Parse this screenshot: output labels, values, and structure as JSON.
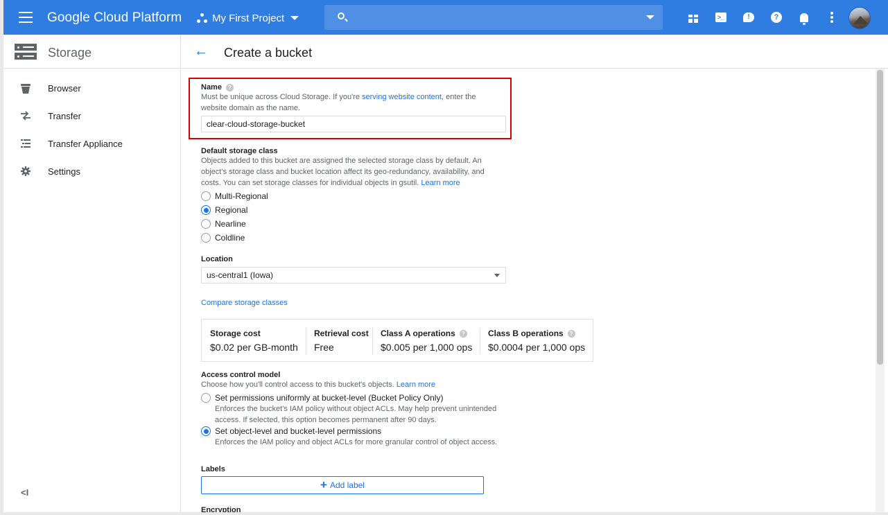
{
  "topbar": {
    "brand": "Google Cloud Platform",
    "project": "My First Project"
  },
  "sidebar": {
    "title": "Storage",
    "items": [
      {
        "label": "Browser",
        "icon": "bucket-icon"
      },
      {
        "label": "Transfer",
        "icon": "transfer-arrows-icon"
      },
      {
        "label": "Transfer Appliance",
        "icon": "list-icon"
      },
      {
        "label": "Settings",
        "icon": "gear-icon"
      }
    ],
    "collapse_glyph": "<I"
  },
  "header": {
    "title": "Create a bucket"
  },
  "form": {
    "name": {
      "label": "Name",
      "help_before": "Must be unique across Cloud Storage. If you're ",
      "help_link": "serving website content",
      "help_after": ", enter the website domain as the name.",
      "value": "clear-cloud-storage-bucket"
    },
    "storage_class": {
      "label": "Default storage class",
      "help": "Objects added to this bucket are assigned the selected storage class by default. An object's storage class and bucket location affect its geo-redundancy, availability, and costs. You can set storage classes for individual objects in gsutil.",
      "learn_more": "Learn more",
      "options": [
        "Multi-Regional",
        "Regional",
        "Nearline",
        "Coldline"
      ],
      "selected": "Regional"
    },
    "location": {
      "label": "Location",
      "value": "us-central1 (Iowa)"
    },
    "compare_link": "Compare storage classes",
    "costs": [
      {
        "header": "Storage cost",
        "value": "$0.02 per GB-month",
        "help": false
      },
      {
        "header": "Retrieval cost",
        "value": "Free",
        "help": false
      },
      {
        "header": "Class A operations",
        "value": "$0.005 per 1,000 ops",
        "help": true
      },
      {
        "header": "Class B operations",
        "value": "$0.0004 per 1,000 ops",
        "help": true
      }
    ],
    "access_control": {
      "label": "Access control model",
      "help": "Choose how you'll control access to this bucket's objects.",
      "learn_more": "Learn more",
      "options": [
        {
          "label": "Set permissions uniformly at bucket-level (Bucket Policy Only)",
          "desc1": "Enforces the bucket's IAM policy without object ACLs. May help prevent unintended",
          "desc2": "access. If selected, this option becomes permanent after 90 days.",
          "checked": false
        },
        {
          "label": "Set object-level and bucket-level permissions",
          "desc1": "Enforces the IAM policy and object ACLs for more granular control of object access.",
          "checked": true
        }
      ]
    },
    "labels": {
      "label": "Labels",
      "add_button": "Add label"
    },
    "encryption": {
      "label": "Encryption"
    }
  },
  "colors": {
    "topbar": "#2f7de1",
    "accent": "#1a73e8",
    "highlight_border": "#d50000"
  }
}
